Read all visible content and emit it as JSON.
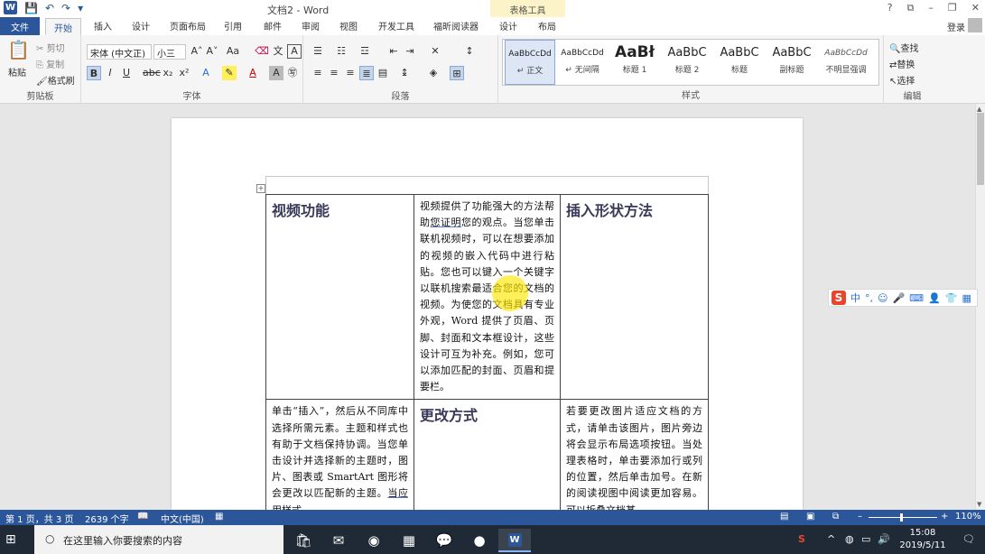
{
  "window": {
    "title": "文档2 - Word",
    "contextual_group": "表格工具",
    "login": "登录",
    "controls": [
      "?",
      "⧉",
      "–",
      "❐",
      "✕"
    ]
  },
  "tabs": [
    "文件",
    "开始",
    "插入",
    "设计",
    "页面布局",
    "引用",
    "邮件",
    "审阅",
    "视图",
    "开发工具",
    "福昕阅读器",
    "设计",
    "布局"
  ],
  "ribbon": {
    "clipboard": {
      "paste": "粘贴",
      "cut": "剪切",
      "copy": "复制",
      "format_painter": "格式刷",
      "label": "剪贴板"
    },
    "font": {
      "font_name": "宋体 (中文正)",
      "font_size": "小三",
      "label": "字体"
    },
    "paragraph": {
      "label": "段落"
    },
    "styles": {
      "label": "样式",
      "items": [
        {
          "sample": "AaBbCcDd",
          "name": "↵ 正文"
        },
        {
          "sample": "AaBbCcDd",
          "name": "↵ 无间隔"
        },
        {
          "sample": "AaBł",
          "name": "标题 1"
        },
        {
          "sample": "AaBbC",
          "name": "标题 2"
        },
        {
          "sample": "AaBbC",
          "name": "标题"
        },
        {
          "sample": "AaBbC",
          "name": "副标题"
        },
        {
          "sample": "AaBbCcDd",
          "name": "不明显强调"
        }
      ]
    },
    "editing": {
      "find": "查找",
      "replace": "替换",
      "select": "选择",
      "label": "编辑"
    }
  },
  "document": {
    "r1c1": "视频功能",
    "r1c2_pre": "视频提供了功能强大的方法帮助",
    "r1c2_link": "您证明",
    "r1c2_post": "您的观点。当您单击联机视频时，可以在想要添加的视频的嵌入代码中进行粘贴。您也可以键入一个关键字以联机搜索最适合您的文档的视频。为使您的文档具有专业外观，Word 提供了页眉、页脚、封面和文本框设计，这些设计可互为补充。例如，您可以添加匹配的封面、页眉和提要栏。",
    "r1c3": "插入形状方法",
    "r2c1_pre": "单击“插入”，然后从不同库中选择所需元素。主题和样式也有助于文档保持协调。当您单击设计并选择新的主题时，图片、图表或 SmartArt 图形将会更改以匹配新的主题。",
    "r2c1_link": "当应用",
    "r2c1_post": "样式",
    "r2c2": "更改方式",
    "r2c3": "若要更改图片适应文档的方式，请单击该图片，图片旁边将会显示布局选项按钮。当处理表格时，单击要添加行或列的位置，然后单击加号。在新的阅读视图中阅读更加容易。可以折叠文档某"
  },
  "status": {
    "page": "第 1 页，共 3 页",
    "words": "2639 个字",
    "language": "中文(中国)",
    "zoom": "110%",
    "zoom_value": 110
  },
  "taskbar": {
    "search_placeholder": "在这里输入你要搜索的内容",
    "time": "15:08",
    "date": "2019/5/11"
  }
}
